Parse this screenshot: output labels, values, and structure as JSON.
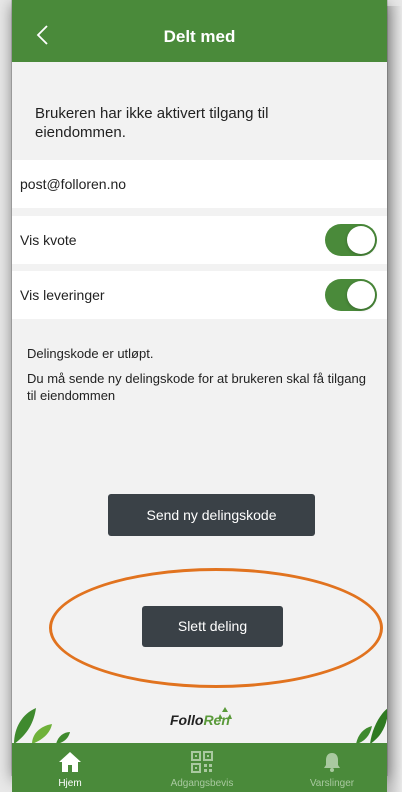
{
  "header": {
    "title": "Delt med",
    "back_icon": "chevron-left-icon"
  },
  "info": {
    "text": "Brukeren har ikke aktivert tilgang til eiendommen."
  },
  "share": {
    "email": "post@folloren.no",
    "vis_kvote_label": "Vis kvote",
    "vis_kvote_on": true,
    "vis_leveringer_label": "Vis leveringer",
    "vis_leveringer_on": true
  },
  "status": {
    "expired": "Delingskode er utløpt.",
    "detail": "Du må sende ny delingskode for at brukeren skal få tilgang til eiendommen"
  },
  "actions": {
    "send_label": "Send ny delingskode",
    "delete_label": "Slett deling"
  },
  "footer": {
    "logo_part1": "Follo",
    "logo_part2": "Ren"
  },
  "tabs": [
    {
      "label": "Hjem",
      "icon": "home-icon",
      "active": true
    },
    {
      "label": "Adgangsbevis",
      "icon": "qr-code-icon",
      "active": false
    },
    {
      "label": "Varslinger",
      "icon": "bell-icon",
      "active": false
    }
  ],
  "colors": {
    "brand_green": "#4a8a3a",
    "dark_button": "#3a4147",
    "highlight_orange": "#e1731f",
    "background": "#f2f2f2"
  }
}
